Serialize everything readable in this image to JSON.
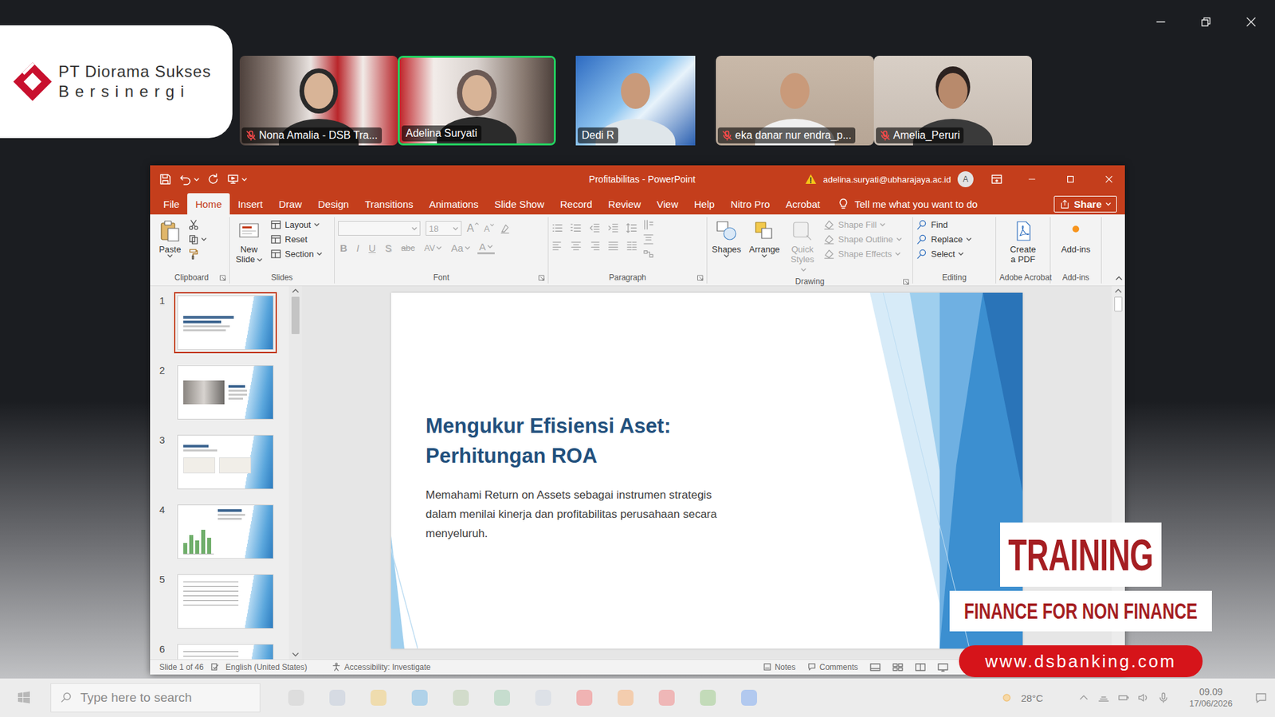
{
  "logo": {
    "line1": "PT Diorama Sukses",
    "line2": "Bersinergi"
  },
  "participants": [
    {
      "name": "Nona Amalia - DSB Tra...",
      "muted": true,
      "speaking": false
    },
    {
      "name": "Adelina Suryati",
      "muted": false,
      "speaking": true
    },
    {
      "name": "Dedi R",
      "muted": false,
      "speaking": false
    },
    {
      "name": "eka danar nur endra_p...",
      "muted": true,
      "speaking": false
    },
    {
      "name": "Amelia_Peruri",
      "muted": true,
      "speaking": false
    }
  ],
  "powerpoint": {
    "title": "Profitabilitas - PowerPoint",
    "account": {
      "email": "adelina.suryati@ubharajaya.ac.id",
      "avatar": "A"
    },
    "tabs": [
      {
        "label": "File",
        "selected": false
      },
      {
        "label": "Home",
        "selected": true
      },
      {
        "label": "Insert",
        "selected": false
      },
      {
        "label": "Draw",
        "selected": false
      },
      {
        "label": "Design",
        "selected": false
      },
      {
        "label": "Transitions",
        "selected": false
      },
      {
        "label": "Animations",
        "selected": false
      },
      {
        "label": "Slide Show",
        "selected": false
      },
      {
        "label": "Record",
        "selected": false
      },
      {
        "label": "Review",
        "selected": false
      },
      {
        "label": "View",
        "selected": false
      },
      {
        "label": "Help",
        "selected": false
      },
      {
        "label": "Nitro Pro",
        "selected": false
      },
      {
        "label": "Acrobat",
        "selected": false
      }
    ],
    "tell_me": "Tell me what you want to do",
    "share": "Share",
    "ribbon": {
      "clipboard": {
        "label": "Clipboard",
        "paste": "Paste"
      },
      "slides": {
        "label": "Slides",
        "new_slide": "New Slide",
        "items": [
          {
            "label": "Layout",
            "dropdown": true
          },
          {
            "label": "Reset",
            "dropdown": false
          },
          {
            "label": "Section",
            "dropdown": true
          }
        ]
      },
      "font": {
        "label": "Font",
        "disabled": true,
        "size": "18",
        "grow": "A",
        "shrink": "A",
        "buttons": [
          {
            "label": "B",
            "dropdown": false
          },
          {
            "label": "I",
            "dropdown": false
          },
          {
            "label": "U",
            "dropdown": false
          },
          {
            "label": "S",
            "dropdown": false
          },
          {
            "label": "abc",
            "dropdown": false
          },
          {
            "label": "AV",
            "dropdown": true
          },
          {
            "label": "Aa",
            "dropdown": true
          },
          {
            "label": "A",
            "dropdown": true
          }
        ]
      },
      "paragraph": {
        "label": "Paragraph",
        "disabled": true
      },
      "drawing": {
        "label": "Drawing",
        "shapes": "Shapes",
        "arrange": "Arrange",
        "quick_styles": {
          "label": "Quick Styles",
          "disabled": true
        },
        "items": [
          {
            "label": "Shape Fill",
            "disabled": true,
            "dropdown": true
          },
          {
            "label": "Shape Outline",
            "disabled": true,
            "dropdown": true
          },
          {
            "label": "Shape Effects",
            "disabled": true,
            "dropdown": true
          }
        ]
      },
      "editing": {
        "label": "Editing",
        "items": [
          {
            "label": "Find",
            "dropdown": false
          },
          {
            "label": "Replace",
            "dropdown": true
          },
          {
            "label": "Select",
            "dropdown": true
          }
        ]
      },
      "acrobat": {
        "label": "Adobe Acrobat",
        "create_pdf": "Create a PDF"
      },
      "addins": {
        "label": "Add-ins",
        "button": "Add-ins"
      }
    },
    "thumbnails": [
      {
        "number": "1",
        "kind": "title",
        "selected": true
      },
      {
        "number": "2",
        "kind": "photo",
        "selected": false
      },
      {
        "number": "3",
        "kind": "formula",
        "selected": false
      },
      {
        "number": "4",
        "kind": "chart",
        "selected": false
      },
      {
        "number": "5",
        "kind": "table",
        "selected": false
      },
      {
        "number": "6",
        "kind": "table",
        "selected": false
      }
    ],
    "slide": {
      "title_lines": [
        "Mengukur Efisiensi Aset:",
        "Perhitungan ROA"
      ],
      "body_lines": [
        "Memahami Return on Assets sebagai instrumen strategis",
        "dalam menilai kinerja dan profitabilitas perusahaan secara",
        "menyeluruh."
      ]
    },
    "status_bar": {
      "slide": "Slide 1 of 46",
      "language": "English (United States)",
      "accessibility": "Accessibility: Investigate",
      "notes": "Notes",
      "comments": "Comments"
    }
  },
  "overlay": {
    "headline": "TRAINING",
    "subtitle": "FINANCE FOR NON FINANCE",
    "url": "www.dsbanking.com"
  },
  "taskbar": {
    "search_placeholder": "Type here to search",
    "weather": "28°C",
    "time": "09.09",
    "date": "17/06/2026"
  }
}
